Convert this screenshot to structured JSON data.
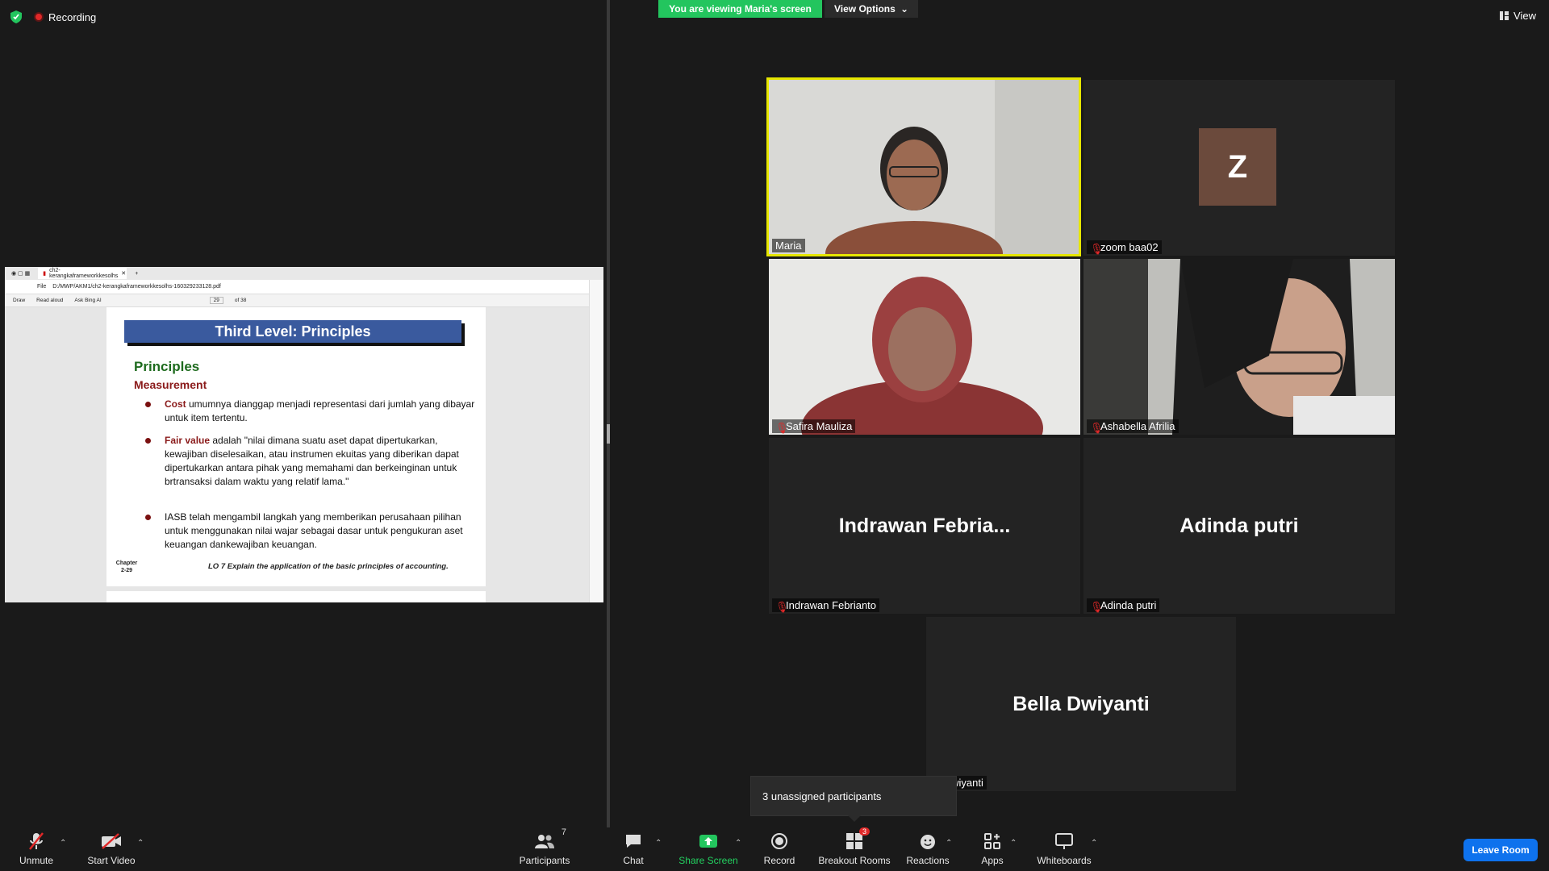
{
  "top": {
    "recording_label": "Recording",
    "viewing_banner": "You are viewing Maria's screen",
    "view_options_label": "View Options",
    "view_label": "View"
  },
  "shared_screen": {
    "tab_title": "ch2-kerangkaframeworkkesolhs",
    "address_prefix": "File",
    "address": "D:/MWP/AKM1/ch2-kerangkaframeworkkesolhs-160329233128.pdf",
    "toolbar": {
      "draw_label": "Draw",
      "read_aloud_label": "Read aloud",
      "ask_label": "Ask Bing AI",
      "page_current": "29",
      "page_total": "of 38"
    },
    "slide": {
      "title": "Third Level: Principles",
      "heading": "Principles",
      "subheading": "Measurement",
      "bullet1_kw": "Cost",
      "bullet1_text": " umumnya dianggap menjadi representasi  dari jumlah yang dibayar untuk item tertentu.",
      "bullet2_kw": "Fair value",
      "bullet2_text": " adalah \"nilai dimana suatu aset dapat dipertukarkan, kewajiban diselesaikan, atau instrumen ekuitas yang diberikan dapat dipertukarkan antara pihak yang memahami dan berkeinginan untuk brtransaksi dalam waktu yang relatif lama.\"",
      "bullet3_text": "IASB telah mengambil langkah yang memberikan perusahaan pilihan untuk menggunakan nilai wajar sebagai dasar untuk pengukuran aset keuangan dankewajiban keuangan.",
      "chapter_label": "Chapter",
      "chapter_num": "2-29",
      "lo_text": "LO 7  Explain the application of the basic principles of accounting."
    }
  },
  "participants": [
    {
      "name": "Maria",
      "type": "video",
      "active": true
    },
    {
      "name": "zoom baa02",
      "type": "avatar",
      "initial": "Z",
      "muted": true
    },
    {
      "name": "Safira Mauliza",
      "type": "video",
      "muted": true
    },
    {
      "name": "Ashabella Afrilia",
      "type": "video",
      "muted": true
    },
    {
      "name": "Indrawan Febrianto",
      "display": "Indrawan  Febria...",
      "type": "name",
      "muted": true
    },
    {
      "name": "Adinda putri",
      "display": "Adinda putri",
      "type": "name",
      "muted": true
    },
    {
      "name": "la Dwiyanti",
      "display": "Bella Dwiyanti",
      "type": "name"
    }
  ],
  "tooltip": "3 unassigned participants",
  "toolbar": {
    "unmute": "Unmute",
    "start_video": "Start Video",
    "participants": "Participants",
    "participants_count": "7",
    "chat": "Chat",
    "share_screen": "Share Screen",
    "record": "Record",
    "breakout_rooms": "Breakout Rooms",
    "breakout_badge": "3",
    "reactions": "Reactions",
    "apps": "Apps",
    "whiteboards": "Whiteboards",
    "leave_room": "Leave Room"
  },
  "colors": {
    "banner_green": "#23c55e",
    "active_speaker": "#e6e600",
    "leave_blue": "#0e72ed",
    "avatar_brown": "#6b4a3c"
  }
}
